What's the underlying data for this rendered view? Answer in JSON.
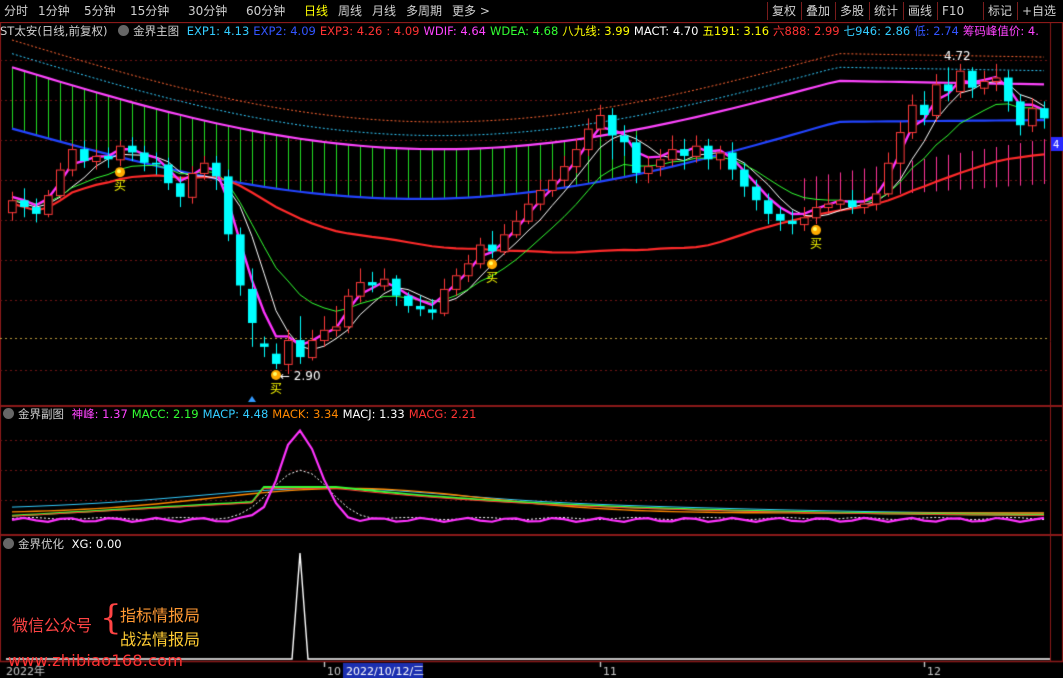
{
  "toolbar": {
    "periods": [
      "分时",
      "1分钟",
      "5分钟",
      "15分钟",
      "30分钟",
      "60分钟",
      "日线",
      "周线",
      "月线",
      "多周期",
      "更多 >"
    ],
    "active_period": "日线",
    "actions": [
      "复权",
      "叠加",
      "多股",
      "统计",
      "画线",
      "F10",
      "标记",
      "+自选"
    ]
  },
  "main_panel": {
    "title_prefix": "ST太安(日线,前复权)",
    "indicator_name": "金界主图",
    "fields": [
      {
        "label": "EXP1: 4.13",
        "color": "#33ccff"
      },
      {
        "label": "EXP2: 4.09",
        "color": "#3355ff"
      },
      {
        "label": "EXP3: 4.26",
        "color": "#ff3333"
      },
      {
        "label": ": 4.09",
        "color": "#ff3333"
      },
      {
        "label": "WDIF: 4.64",
        "color": "#ff44ff"
      },
      {
        "label": "WDEA: 4.68",
        "color": "#33ff33"
      },
      {
        "label": "八九线: 3.99",
        "color": "#ffff00"
      },
      {
        "label": "MACT: 4.70",
        "color": "#ffffff"
      },
      {
        "label": "五191: 3.16",
        "color": "#ffff00"
      },
      {
        "label": "六888: 2.99",
        "color": "#ff3333"
      },
      {
        "label": "七946: 2.86",
        "color": "#33ccff"
      },
      {
        "label": "低: 2.74",
        "color": "#3355ff"
      },
      {
        "label": "筹码峰值价: 4.",
        "color": "#ff44ff"
      }
    ],
    "right_marker": "4",
    "annotations": {
      "high_label": "4.72",
      "low_label": "2.90",
      "buy_label": "买"
    }
  },
  "sub_panel": {
    "indicator_name": "金界副图",
    "fields": [
      {
        "label": "神峰: 1.37",
        "color": "#ff44ff"
      },
      {
        "label": "MACC: 2.19",
        "color": "#33ff33"
      },
      {
        "label": "MACP: 4.48",
        "color": "#33ccff"
      },
      {
        "label": "MACK: 3.34",
        "color": "#ff8800"
      },
      {
        "label": "MACJ: 1.33",
        "color": "#ffffff"
      },
      {
        "label": "MACG: 2.21",
        "color": "#ff3333"
      }
    ]
  },
  "opt_panel": {
    "indicator_name": "金界优化",
    "fields": [
      {
        "label": "XG: 0.00",
        "color": "#ffffff"
      }
    ]
  },
  "watermark": {
    "wechat_label": "微信公众号",
    "brace": "{",
    "line1": "指标情报局",
    "line2": "战法情报局",
    "url": "www.zhibiao168.com"
  },
  "x_axis": {
    "year_label": "2022年",
    "ticks": [
      "10",
      "11",
      "12"
    ],
    "cursor_date": "2022/10/12/三"
  },
  "chart_data": {
    "type": "candlestick",
    "candles": [
      [
        3.85,
        3.92,
        3.97,
        3.8
      ],
      [
        3.92,
        3.88,
        3.99,
        3.82
      ],
      [
        3.88,
        3.84,
        3.93,
        3.79
      ],
      [
        3.84,
        3.95,
        3.98,
        3.82
      ],
      [
        3.95,
        4.1,
        4.14,
        3.93
      ],
      [
        4.1,
        4.22,
        4.25,
        4.06
      ],
      [
        4.22,
        4.15,
        4.27,
        4.11
      ],
      [
        4.15,
        4.18,
        4.22,
        4.1
      ],
      [
        4.18,
        4.16,
        4.23,
        4.11
      ],
      [
        4.16,
        4.24,
        4.27,
        4.12
      ],
      [
        4.24,
        4.2,
        4.29,
        4.15
      ],
      [
        4.2,
        4.14,
        4.24,
        4.09
      ],
      [
        4.14,
        4.13,
        4.2,
        4.07
      ],
      [
        4.13,
        4.02,
        4.17,
        3.98
      ],
      [
        4.02,
        3.94,
        4.06,
        3.88
      ],
      [
        3.94,
        4.08,
        4.12,
        3.9
      ],
      [
        4.08,
        4.14,
        4.18,
        4.04
      ],
      [
        4.14,
        4.06,
        4.18,
        3.98
      ],
      [
        4.06,
        3.72,
        4.1,
        3.68
      ],
      [
        3.72,
        3.42,
        3.76,
        3.36
      ],
      [
        3.4,
        3.2,
        3.52,
        3.06
      ],
      [
        3.08,
        3.06,
        3.12,
        3.0
      ],
      [
        3.02,
        2.96,
        3.08,
        2.93
      ],
      [
        2.96,
        3.1,
        3.16,
        2.9
      ],
      [
        3.1,
        3.0,
        3.24,
        2.96
      ],
      [
        3.0,
        3.1,
        3.16,
        2.98
      ],
      [
        3.1,
        3.16,
        3.24,
        3.06
      ],
      [
        3.16,
        3.18,
        3.3,
        3.12
      ],
      [
        3.18,
        3.36,
        3.4,
        3.14
      ],
      [
        3.36,
        3.44,
        3.52,
        3.32
      ],
      [
        3.44,
        3.42,
        3.5,
        3.38
      ],
      [
        3.42,
        3.46,
        3.52,
        3.39
      ],
      [
        3.46,
        3.36,
        3.48,
        3.3
      ],
      [
        3.36,
        3.3,
        3.38,
        3.26
      ],
      [
        3.3,
        3.28,
        3.36,
        3.24
      ],
      [
        3.28,
        3.26,
        3.34,
        3.22
      ],
      [
        3.26,
        3.4,
        3.46,
        3.24
      ],
      [
        3.4,
        3.48,
        3.52,
        3.36
      ],
      [
        3.48,
        3.55,
        3.6,
        3.44
      ],
      [
        3.55,
        3.66,
        3.7,
        3.52
      ],
      [
        3.66,
        3.62,
        3.74,
        3.58
      ],
      [
        3.62,
        3.72,
        3.78,
        3.6
      ],
      [
        3.72,
        3.8,
        3.86,
        3.7
      ],
      [
        3.8,
        3.9,
        3.96,
        3.78
      ],
      [
        3.9,
        3.98,
        4.04,
        3.86
      ],
      [
        3.98,
        4.04,
        4.1,
        3.94
      ],
      [
        4.04,
        4.12,
        4.18,
        4.0
      ],
      [
        4.12,
        4.22,
        4.28,
        4.08
      ],
      [
        4.22,
        4.34,
        4.4,
        4.18
      ],
      [
        4.34,
        4.42,
        4.48,
        4.3
      ],
      [
        4.42,
        4.3,
        4.46,
        4.16
      ],
      [
        4.3,
        4.26,
        4.36,
        4.18
      ],
      [
        4.26,
        4.08,
        4.3,
        4.02
      ],
      [
        4.08,
        4.12,
        4.18,
        4.02
      ],
      [
        4.12,
        4.16,
        4.22,
        4.06
      ],
      [
        4.16,
        4.22,
        4.3,
        4.12
      ],
      [
        4.22,
        4.18,
        4.28,
        4.1
      ],
      [
        4.18,
        4.24,
        4.3,
        4.14
      ],
      [
        4.24,
        4.16,
        4.28,
        4.1
      ],
      [
        4.16,
        4.2,
        4.24,
        4.1
      ],
      [
        4.2,
        4.1,
        4.26,
        4.04
      ],
      [
        4.1,
        4.0,
        4.14,
        3.94
      ],
      [
        4.0,
        3.92,
        4.04,
        3.86
      ],
      [
        3.92,
        3.84,
        3.96,
        3.78
      ],
      [
        3.84,
        3.8,
        3.88,
        3.74
      ],
      [
        3.8,
        3.78,
        3.86,
        3.72
      ],
      [
        3.78,
        3.82,
        3.88,
        3.74
      ],
      [
        3.82,
        3.88,
        3.92,
        3.78
      ],
      [
        3.88,
        3.9,
        3.96,
        3.84
      ],
      [
        3.9,
        3.92,
        3.98,
        3.86
      ],
      [
        3.92,
        3.88,
        3.98,
        3.84
      ],
      [
        3.88,
        3.9,
        3.96,
        3.84
      ],
      [
        3.9,
        3.96,
        4.0,
        3.86
      ],
      [
        3.96,
        4.14,
        4.2,
        3.94
      ],
      [
        4.14,
        4.32,
        4.38,
        4.1
      ],
      [
        4.32,
        4.48,
        4.54,
        4.28
      ],
      [
        4.48,
        4.42,
        4.56,
        4.36
      ],
      [
        4.42,
        4.6,
        4.66,
        4.38
      ],
      [
        4.6,
        4.56,
        4.7,
        4.5
      ],
      [
        4.56,
        4.68,
        4.72,
        4.52
      ],
      [
        4.68,
        4.58,
        4.7,
        4.52
      ],
      [
        4.58,
        4.62,
        4.68,
        4.54
      ],
      [
        4.62,
        4.64,
        4.72,
        4.56
      ],
      [
        4.64,
        4.5,
        4.68,
        4.44
      ],
      [
        4.5,
        4.36,
        4.54,
        4.3
      ],
      [
        4.36,
        4.46,
        4.52,
        4.32
      ],
      [
        4.46,
        4.4,
        4.5,
        4.34
      ]
    ],
    "price_range": [
      2.76,
      4.86
    ],
    "annotations": {
      "high": 4.72,
      "low": 2.9
    },
    "buy_points": [
      9,
      22,
      40,
      67
    ],
    "xg_spike_index": 24
  }
}
